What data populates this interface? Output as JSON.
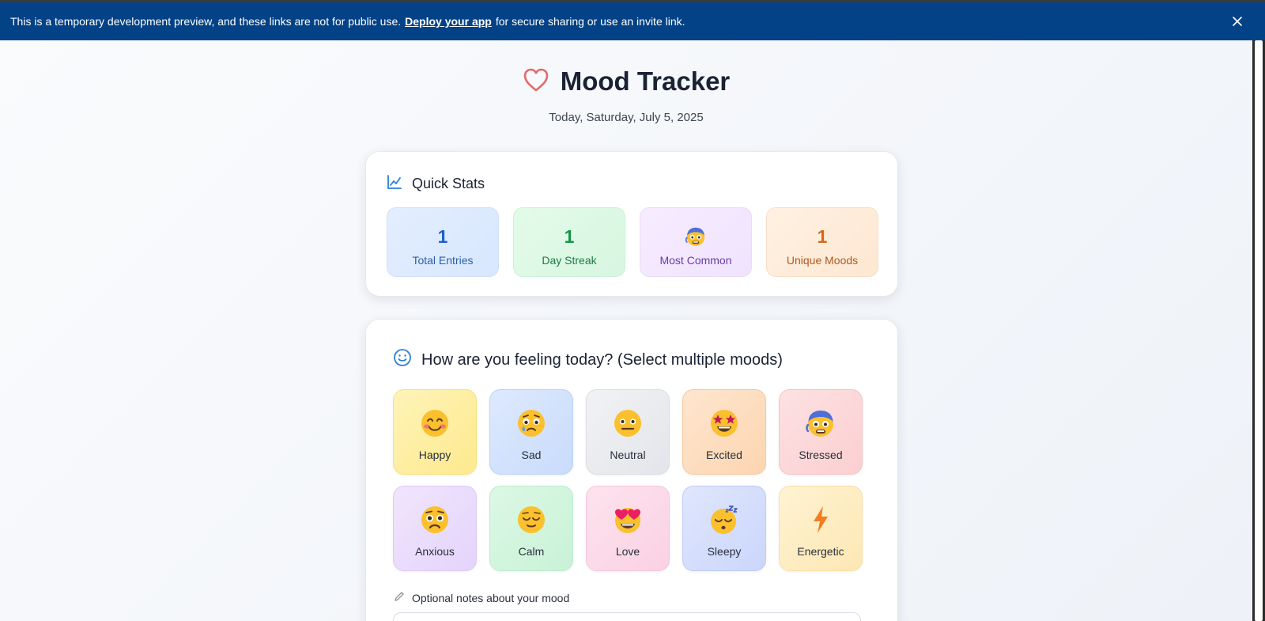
{
  "banner": {
    "text_before": "This is a temporary development preview, and these links are not for public use.",
    "link_text": "Deploy your app",
    "text_after": "for secure sharing or use an invite link.",
    "close_icon": "close-icon"
  },
  "header": {
    "title": "Mood Tracker",
    "subtitle": "Today, Saturday, July 5, 2025",
    "icon": "heart-icon",
    "icon_color": "#e06b6b"
  },
  "stats": {
    "title": "Quick Stats",
    "icon": "chart-line-icon",
    "items": [
      {
        "value": "1",
        "label": "Total Entries"
      },
      {
        "value": "1",
        "label": "Day Streak"
      },
      {
        "value_icon": "stressed-emoji-icon",
        "label": "Most Common"
      },
      {
        "value": "1",
        "label": "Unique Moods"
      }
    ]
  },
  "mood_picker": {
    "title": "How are you feeling today? (Select multiple moods)",
    "icon": "smile-icon",
    "moods": [
      {
        "label": "Happy",
        "icon": "happy-emoji-icon",
        "color": "#fff0a8"
      },
      {
        "label": "Sad",
        "icon": "sad-emoji-icon",
        "color": "#d4e5fd"
      },
      {
        "label": "Neutral",
        "icon": "neutral-emoji-icon",
        "color": "#eceef2"
      },
      {
        "label": "Excited",
        "icon": "excited-emoji-icon",
        "color": "#fde0c4"
      },
      {
        "label": "Stressed",
        "icon": "stressed-emoji-icon",
        "color": "#fdd9da"
      },
      {
        "label": "Anxious",
        "icon": "anxious-emoji-icon",
        "color": "#ecdffb"
      },
      {
        "label": "Calm",
        "icon": "calm-emoji-icon",
        "color": "#d3f5df"
      },
      {
        "label": "Love",
        "icon": "love-emoji-icon",
        "color": "#fbdcea"
      },
      {
        "label": "Sleepy",
        "icon": "sleepy-emoji-icon",
        "color": "#d6dffb"
      },
      {
        "label": "Energetic",
        "icon": "lightning-icon",
        "color": "#fff0c4"
      }
    ]
  },
  "notes": {
    "label": "Optional notes about your mood",
    "icon": "pencil-icon"
  }
}
